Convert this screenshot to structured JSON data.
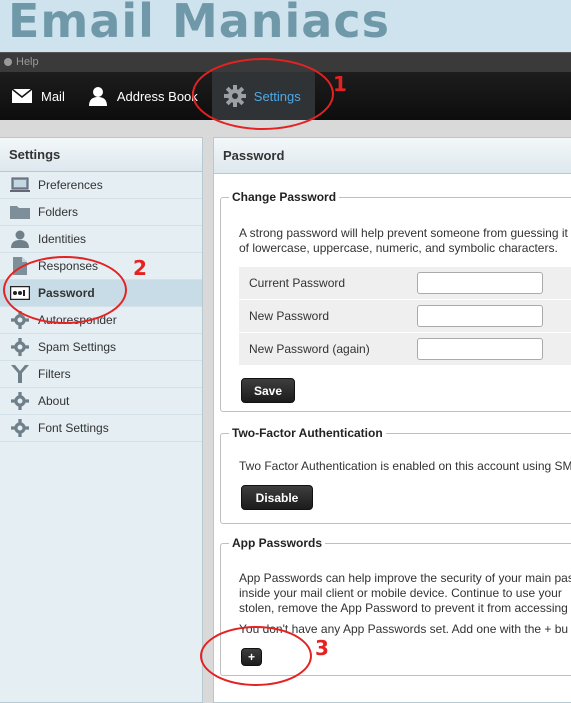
{
  "brand": {
    "title": "Email Maniacs"
  },
  "topbar": {
    "help_label": "Help"
  },
  "nav": {
    "items": [
      {
        "label": "Mail",
        "icon": "envelope-icon"
      },
      {
        "label": "Address Book",
        "icon": "person-icon"
      },
      {
        "label": "Settings",
        "icon": "gear-icon"
      }
    ],
    "active_color": "#4ea8e6"
  },
  "sidebar": {
    "title": "Settings",
    "items": [
      {
        "label": "Preferences",
        "icon": "monitor-icon"
      },
      {
        "label": "Folders",
        "icon": "folder-icon"
      },
      {
        "label": "Identities",
        "icon": "person-icon"
      },
      {
        "label": "Responses",
        "icon": "document-icon"
      },
      {
        "label": "Password",
        "icon": "password-icon"
      },
      {
        "label": "Autoresponder",
        "icon": "gear-icon"
      },
      {
        "label": "Spam Settings",
        "icon": "gear-icon"
      },
      {
        "label": "Filters",
        "icon": "filter-icon"
      },
      {
        "label": "About",
        "icon": "gear-icon"
      },
      {
        "label": "Font Settings",
        "icon": "gear-icon"
      }
    ],
    "selected": "Password"
  },
  "main": {
    "title": "Password",
    "change_password": {
      "legend": "Change Password",
      "description_line1": "A strong password will help prevent someone from guessing it",
      "description_line2": "of lowercase, uppercase, numeric, and symbolic characters.",
      "fields": [
        {
          "label": "Current Password",
          "value": ""
        },
        {
          "label": "New Password",
          "value": ""
        },
        {
          "label": "New Password (again)",
          "value": ""
        }
      ],
      "save_label": "Save"
    },
    "two_factor": {
      "legend": "Two-Factor Authentication",
      "description": "Two Factor Authentication is enabled on this account using SM",
      "disable_label": "Disable"
    },
    "app_passwords": {
      "legend": "App Passwords",
      "description_line1": "App Passwords can help improve the security of your main pas",
      "description_line2": "inside your mail client or mobile device. Continue to use your",
      "description_line3": "stolen, remove the App Password to prevent it from accessing",
      "empty_text": "You don't have any App Passwords set. Add one with the + bu",
      "add_label": "+"
    }
  },
  "annotations": {
    "one": "1",
    "two": "2",
    "three": "3",
    "color": "#e52222"
  }
}
